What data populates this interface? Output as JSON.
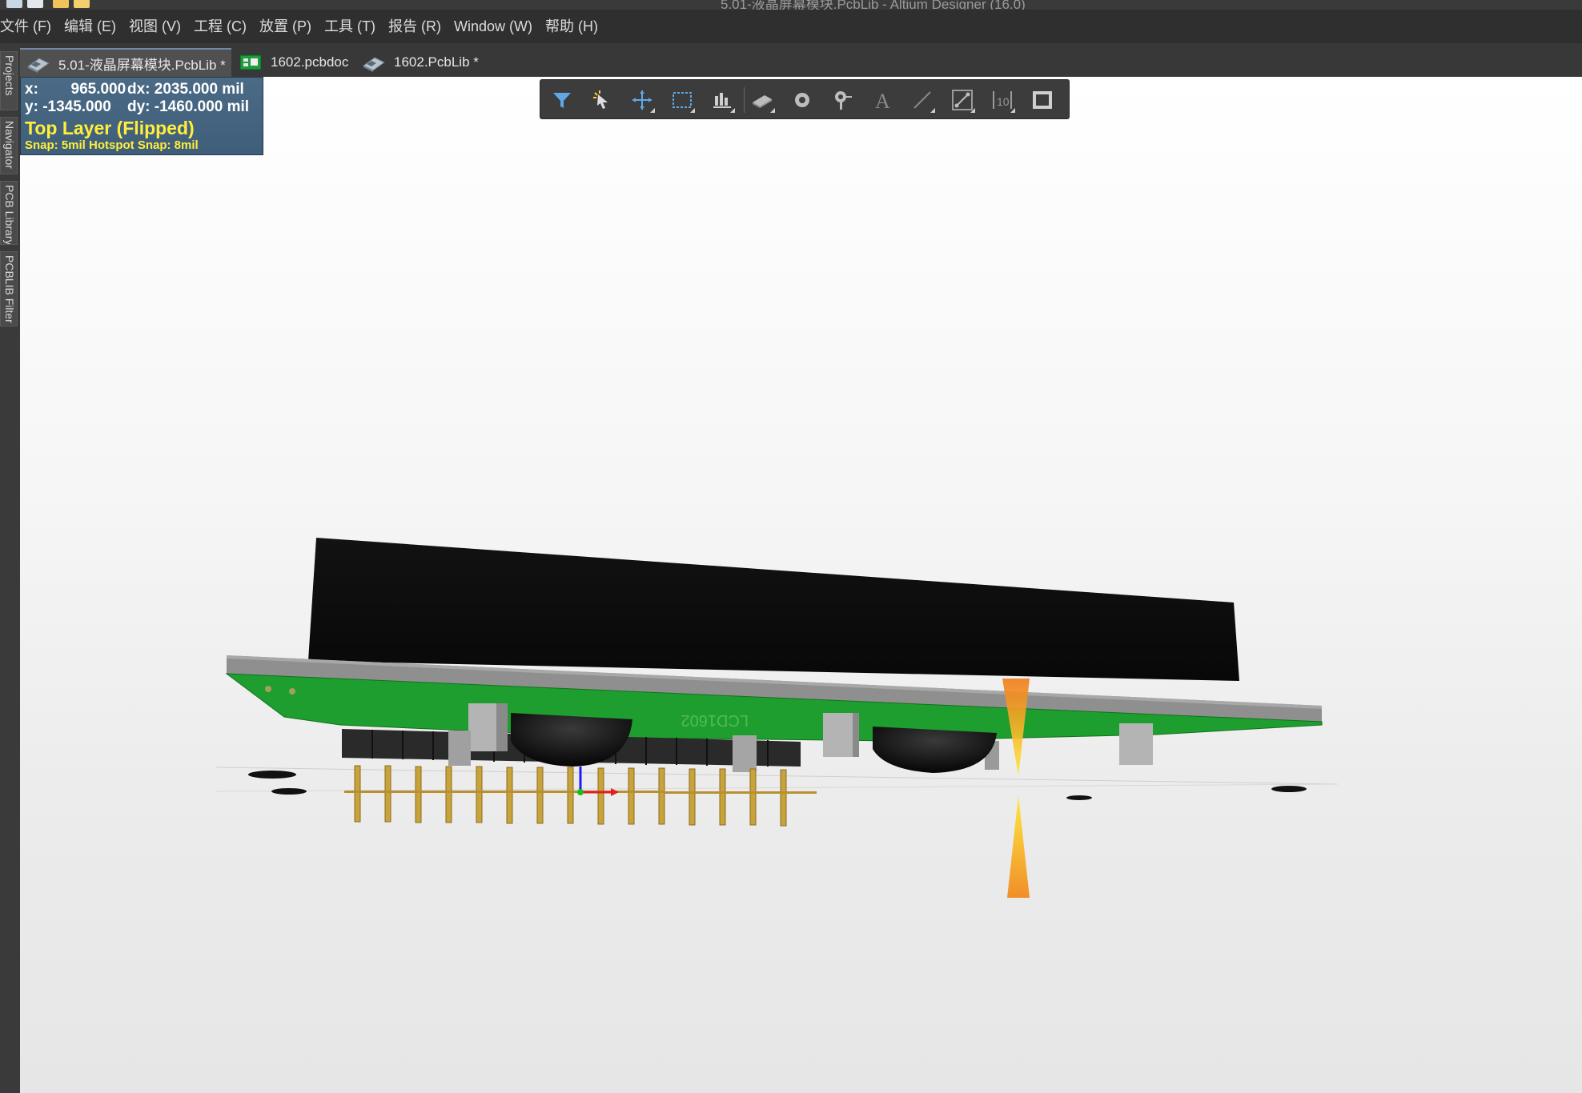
{
  "window": {
    "title": "5.01-液晶屏幕模块.PcbLib - Altium Designer (16.0)"
  },
  "menu": [
    {
      "label": "文件 (F)",
      "name": "menu-file"
    },
    {
      "label": "编辑 (E)",
      "name": "menu-edit"
    },
    {
      "label": "视图 (V)",
      "name": "menu-view"
    },
    {
      "label": "工程 (C)",
      "name": "menu-project"
    },
    {
      "label": "放置 (P)",
      "name": "menu-place"
    },
    {
      "label": "工具 (T)",
      "name": "menu-tools"
    },
    {
      "label": "报告 (R)",
      "name": "menu-reports"
    },
    {
      "label": "Window (W)",
      "name": "menu-window"
    },
    {
      "label": "帮助 (H)",
      "name": "menu-help"
    }
  ],
  "tabs": [
    {
      "label": "5.01-液晶屏幕模块.PcbLib *",
      "icon": "pcblib-icon",
      "active": true
    },
    {
      "label": "1602.pcbdoc",
      "icon": "pcbdoc-icon",
      "active": false
    },
    {
      "label": "1602.PcbLib *",
      "icon": "pcblib-icon",
      "active": false
    }
  ],
  "side_panels": [
    {
      "label": "Projects"
    },
    {
      "label": "Navigator"
    },
    {
      "label": "PCB Library"
    },
    {
      "label": "PCBLIB Filter"
    }
  ],
  "hud": {
    "x_label": "x:",
    "x_value": "965.000",
    "dx_label": "dx:",
    "dx_value": "2035.000 mil",
    "y_label": "y:",
    "y_value": "-1345.000",
    "dy_label": "dy:",
    "dy_value": "-1460.000 mil",
    "layer": "Top Layer (Flipped)",
    "snap": "Snap: 5mil Hotspot Snap: 8mil"
  },
  "toolbar": [
    {
      "icon": "filter-icon"
    },
    {
      "icon": "select-pointer-icon"
    },
    {
      "icon": "move-cross-icon"
    },
    {
      "icon": "select-rect-icon"
    },
    {
      "icon": "align-icon"
    },
    {
      "icon": "component-icon"
    },
    {
      "icon": "pad-icon"
    },
    {
      "icon": "via-icon"
    },
    {
      "icon": "text-icon"
    },
    {
      "icon": "line-icon"
    },
    {
      "icon": "track-icon"
    },
    {
      "icon": "dimension-icon"
    },
    {
      "icon": "region-icon"
    }
  ],
  "board": {
    "silkscreen_text": "LCD1602",
    "colors": {
      "pcb_green": "#1e9e2e",
      "board_edge": "#8c8c8c",
      "lcd_black": "#0c0c0c",
      "pin_gold": "#c8a23a",
      "hud_yellow": "#ffef3a"
    }
  }
}
